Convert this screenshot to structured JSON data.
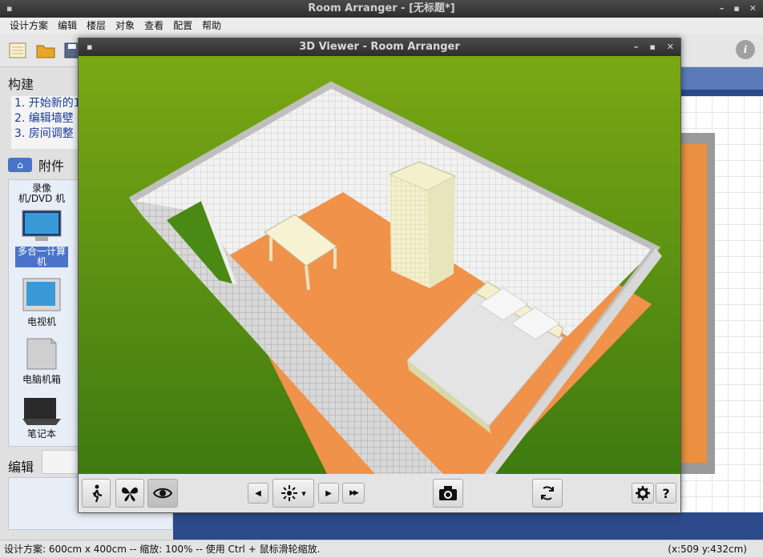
{
  "window": {
    "title": "Room Arranger - [无标题*]",
    "sysmenu": "▪",
    "controls": [
      "–",
      "▪",
      "✕"
    ]
  },
  "menu": [
    "设计方案",
    "编辑",
    "楼层",
    "对象",
    "查看",
    "配置",
    "帮助"
  ],
  "left_panel": {
    "build_title": "构建",
    "steps": [
      "1. 开始新的1",
      "2. 编辑墙壁",
      "3. 房间调整"
    ],
    "attachments_title": "附件",
    "palette": [
      {
        "label": "录像机/DVD 机",
        "icon": "vcr-icon",
        "selected": false
      },
      {
        "label": "多合一计算机",
        "icon": "all-in-one-computer-icon",
        "selected": true
      },
      {
        "label": "电视机",
        "icon": "tv-icon",
        "selected": false
      },
      {
        "label": "电脑机箱",
        "icon": "pc-case-icon",
        "selected": false
      },
      {
        "label": "笔记本",
        "icon": "laptop-icon",
        "selected": false
      }
    ],
    "edit_title": "编辑"
  },
  "viewer": {
    "title": "3D Viewer - Room Arranger",
    "sysmenu": "▪",
    "controls": [
      "–",
      "▪",
      "✕"
    ],
    "toolbar": {
      "walk": "walk-icon",
      "fly": "butterfly-icon",
      "view": "eye-icon",
      "prev": "◀",
      "light": "light-icon",
      "light_dropdown": "▾",
      "next": "▶",
      "fast_forward": "▶▶",
      "screenshot": "camera-icon",
      "refresh": "refresh-icon",
      "settings": "gear-icon",
      "help": "?"
    }
  },
  "statusbar": {
    "text": "设计方案: 600cm x 400cm -- 缩放: 100% -- 使用 Ctrl + 鼠标滑轮缩放.",
    "coords": "(x:509 y:432cm)"
  },
  "info_icon": "i",
  "colors": {
    "grass": "#4a8a14",
    "floor": "#f0924a",
    "wall": "#eeeeee",
    "accent": "#4a74c9"
  }
}
